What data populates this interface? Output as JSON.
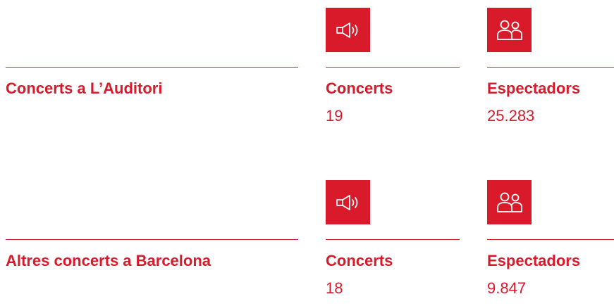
{
  "colors": {
    "accent": "#d81a2a",
    "background": "#ffffff"
  },
  "sections": [
    {
      "title": "Concerts a L’Auditori",
      "stats": [
        {
          "icon": "speaker-icon",
          "label": "Concerts",
          "value": "19"
        },
        {
          "icon": "people-icon",
          "label": "Espectadors",
          "value": "25.283"
        }
      ]
    },
    {
      "title": "Altres concerts a Barcelona",
      "stats": [
        {
          "icon": "speaker-icon",
          "label": "Concerts",
          "value": "18"
        },
        {
          "icon": "people-icon",
          "label": "Espectadors",
          "value": "9.847"
        }
      ]
    }
  ]
}
